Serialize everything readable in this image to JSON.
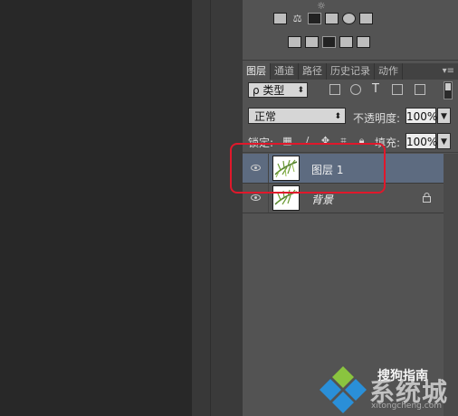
{
  "tabs": [
    {
      "label": "图层",
      "active": true
    },
    {
      "label": "通道",
      "active": false
    },
    {
      "label": "路径",
      "active": false
    },
    {
      "label": "历史记录",
      "active": false
    },
    {
      "label": "动作",
      "active": false
    }
  ],
  "tab_menu_icon": "panel-menu-icon",
  "filter": {
    "kind_label": "ρ 类型",
    "icons": [
      "pixel-filter-icon",
      "adjustment-filter-icon",
      "type-filter-icon",
      "shape-filter-icon",
      "smart-object-filter-icon"
    ],
    "type_glyph": "T"
  },
  "blend": {
    "mode": "正常",
    "opacity_label": "不透明度:",
    "opacity_value": "100%"
  },
  "lock": {
    "label": "锁定:",
    "icons": [
      "lock-transparent-icon",
      "lock-brush-icon",
      "lock-move-icon",
      "lock-artboard-icon",
      "lock-all-icon"
    ],
    "fill_label": "填充:",
    "fill_value": "100%"
  },
  "layers": [
    {
      "name": "图层 1",
      "selected": true,
      "visible": true,
      "locked": false
    },
    {
      "name": "背景",
      "selected": false,
      "visible": true,
      "locked": true
    }
  ],
  "watermark": {
    "sogou": "搜狗指南",
    "brand": "系统城",
    "url": "xitongcheng.com"
  },
  "colors": {
    "selected_row": "#5d6b80",
    "highlight": "#e0182b",
    "panel_bg": "#535353"
  }
}
